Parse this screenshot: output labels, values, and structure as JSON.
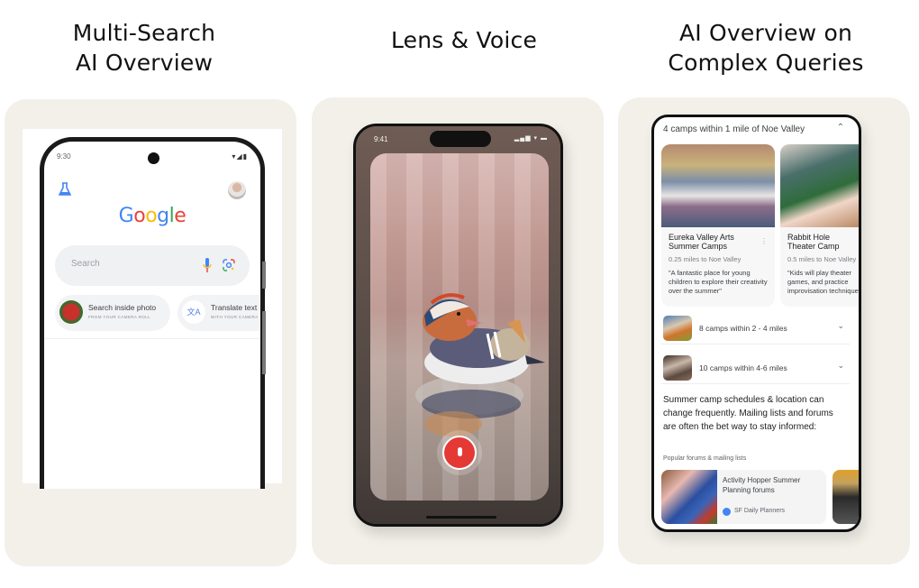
{
  "columns": [
    {
      "title_line1": "Multi-Search",
      "title_line2": "AI Overview",
      "phone": {
        "status_time": "9:30",
        "status_icons": "▾◢▮",
        "logo_letters": [
          {
            "ch": "G",
            "color": "#4285f4"
          },
          {
            "ch": "o",
            "color": "#ea4335"
          },
          {
            "ch": "o",
            "color": "#fbbc05"
          },
          {
            "ch": "g",
            "color": "#4285f4"
          },
          {
            "ch": "l",
            "color": "#34a853"
          },
          {
            "ch": "e",
            "color": "#ea4335"
          }
        ],
        "search_placeholder": "Search",
        "chips": [
          {
            "title": "Search inside photo",
            "subtitle": "FROM YOUR CAMERA ROLL"
          },
          {
            "title": "Translate text",
            "subtitle": "WITH YOUR CAMERA",
            "icon_glyph": "文A"
          }
        ]
      }
    },
    {
      "title_line1": "Lens & Voice",
      "phone": {
        "status_time": "9:41",
        "status_icons": "▂▄▆ ▾ ▬"
      }
    },
    {
      "title_line1": "AI Overview on",
      "title_line2": "Complex Queries",
      "phone": {
        "header": "4 camps within 1 mile of Noe Valley",
        "header_chevron": "⌃",
        "camps": [
          {
            "name": "Eureka Valley Arts Summer Camps",
            "distance": "0.25 miles to Noe Valley",
            "quote": "\"A fantastic place for young children to explore their creativity over the summer\"",
            "more": "⋮"
          },
          {
            "name": "Rabbit Hole Theater Camp",
            "distance": "0.5 miles to Noe Valley",
            "quote": "\"Kids will play theater games, and practice improvisation techniques\""
          }
        ],
        "groups": [
          {
            "label": "8 camps within 2 - 4 miles",
            "chevron": "⌄"
          },
          {
            "label": "10 camps within 4-6 miles",
            "chevron": "⌄"
          }
        ],
        "summary": "Summer camp schedules & location can change frequently. Mailing lists and forums are often the bet way to stay informed:",
        "forums_label": "Popular forums & mailing lists",
        "forum": {
          "title": "Activity Hopper Summer Planning forums",
          "source": "SF Daily Planners"
        }
      }
    }
  ]
}
